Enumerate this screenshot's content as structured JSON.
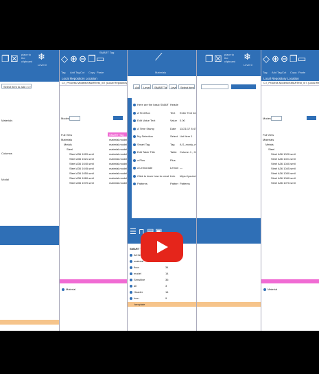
{
  "colors": {
    "ribbon": "#2f6fb6",
    "pink": "#f06bd3",
    "orange": "#f6c48b",
    "play": "#e5251b"
  },
  "video": {
    "play_icon": "play-icon"
  },
  "p1": {
    "ribbon_text": "place to the clipboard",
    "ribbon_sub": "Level 0",
    "select_label": "Select item to add >>>",
    "tree": [
      "Materials",
      "Columns",
      "Modal"
    ]
  },
  "p2": {
    "ribbon": {
      "tag": "SMART Tag",
      "labels": [
        "Tag",
        "Add Tag",
        "Cut",
        "Copy",
        "Paste"
      ]
    },
    "header_title": "Local Repository Location",
    "path": "C:\\_Process Models\\SMARTest_\\07 (Local Repository\\SMARTag Templates",
    "mode_label": "Modes",
    "col_left": "Full View",
    "col_right": "SMART Tag",
    "tree": [
      {
        "label": "Materials",
        "val": "material.model"
      },
      {
        "label": "Metals",
        "val": "material.model"
      },
      {
        "label": "Steel",
        "val": "material.model"
      },
      {
        "label": "Steel A36 1020.smtl",
        "val": "material.model"
      },
      {
        "label": "Steel A36 1021.smtl",
        "val": "material.model"
      },
      {
        "label": "Steel A36 1040.smtl",
        "val": "material.model"
      },
      {
        "label": "Steel A36 1045.smtl",
        "val": "material.model"
      },
      {
        "label": "Steel A36 1050.smtl",
        "val": "material.model"
      },
      {
        "label": "Steel A36 1060.smtl",
        "val": "material.model"
      },
      {
        "label": "Steel A36 1070.smtl",
        "val": "material.model"
      }
    ],
    "bottom_item": "Material"
  },
  "p3": {
    "ribbon_label": "Materials",
    "toolbar": {
      "a": "Add",
      "b": "Level",
      "c": "SMARTTag_n123_cards",
      "d": "Level 2",
      "e": "Select item to add >>>"
    },
    "table": [
      {
        "name": "Here are the basic SMARTTag Elements",
        "type": "Header",
        "value": ""
      },
      {
        "name": "A Text Box",
        "type": "Text",
        "value": "Enter Text here"
      },
      {
        "name": "Edit Value Text",
        "type": "Value",
        "value": "0.00"
      },
      {
        "name": "A Time Stamp",
        "type": "Date",
        "value": "11/21/17 8:47:15 AM"
      },
      {
        "name": "My Selection",
        "type": "Select",
        "value": "List Item 1"
      },
      {
        "name": "Smart Tag",
        "type": "Tag",
        "value": "A.S_mcnly_material"
      },
      {
        "name": "Edit Table Title",
        "type": "Table",
        "value": "Column 1 , Column 2 , Columns"
      },
      {
        "name": "a Plus",
        "type": "Plus",
        "value": ""
      },
      {
        "name": "a Lemonade",
        "type": "Lemonade",
        "value": "—"
      },
      {
        "name": "Click to learn how to create elements >>",
        "type": "Link",
        "value": "https://youtu.be/Rb3u8kfw4k"
      },
      {
        "name": "Patterns",
        "type": "Patterns",
        "value": "Patterns"
      }
    ],
    "grid_header": {
      "tag": "SMART Tags",
      "count": "Count"
    },
    "grid": [
      {
        "tag": "All Items",
        "count": "125"
      },
      {
        "tag": "material",
        "count": "185"
      },
      {
        "tag": "floor",
        "count": "34"
      },
      {
        "tag": "model",
        "count": "14"
      },
      {
        "tag": "Sensitive",
        "count": "36"
      },
      {
        "tag": "all",
        "count": "3"
      },
      {
        "tag": "Header",
        "count": "14"
      },
      {
        "tag": "Icon",
        "count": "9"
      }
    ],
    "highlight_row": "template"
  },
  "p4": {
    "ribbon_text": "place to the clipboard",
    "ribbon_sub": "Level 0"
  },
  "p5": {
    "ribbon": {
      "labels": [
        "Tag",
        "Add Tag",
        "Cut",
        "Copy",
        "Paste"
      ]
    },
    "header_title": "Local Repository Location",
    "path": "C:\\_Process Models\\SMARTest_\\07 (Local Repository\\SMAR",
    "mode_label": "Modes",
    "col_left": "Full View",
    "tree": [
      "Materials",
      "Metals",
      "Steel",
      "Steel A36 1020.smtl",
      "Steel A36 1021.smtl",
      "Steel A36 1040.smtl",
      "Steel A36 1045.smtl",
      "Steel A36 1050.smtl",
      "Steel A36 1060.smtl",
      "Steel A36 1070.smtl"
    ],
    "bottom_item": "Material"
  }
}
